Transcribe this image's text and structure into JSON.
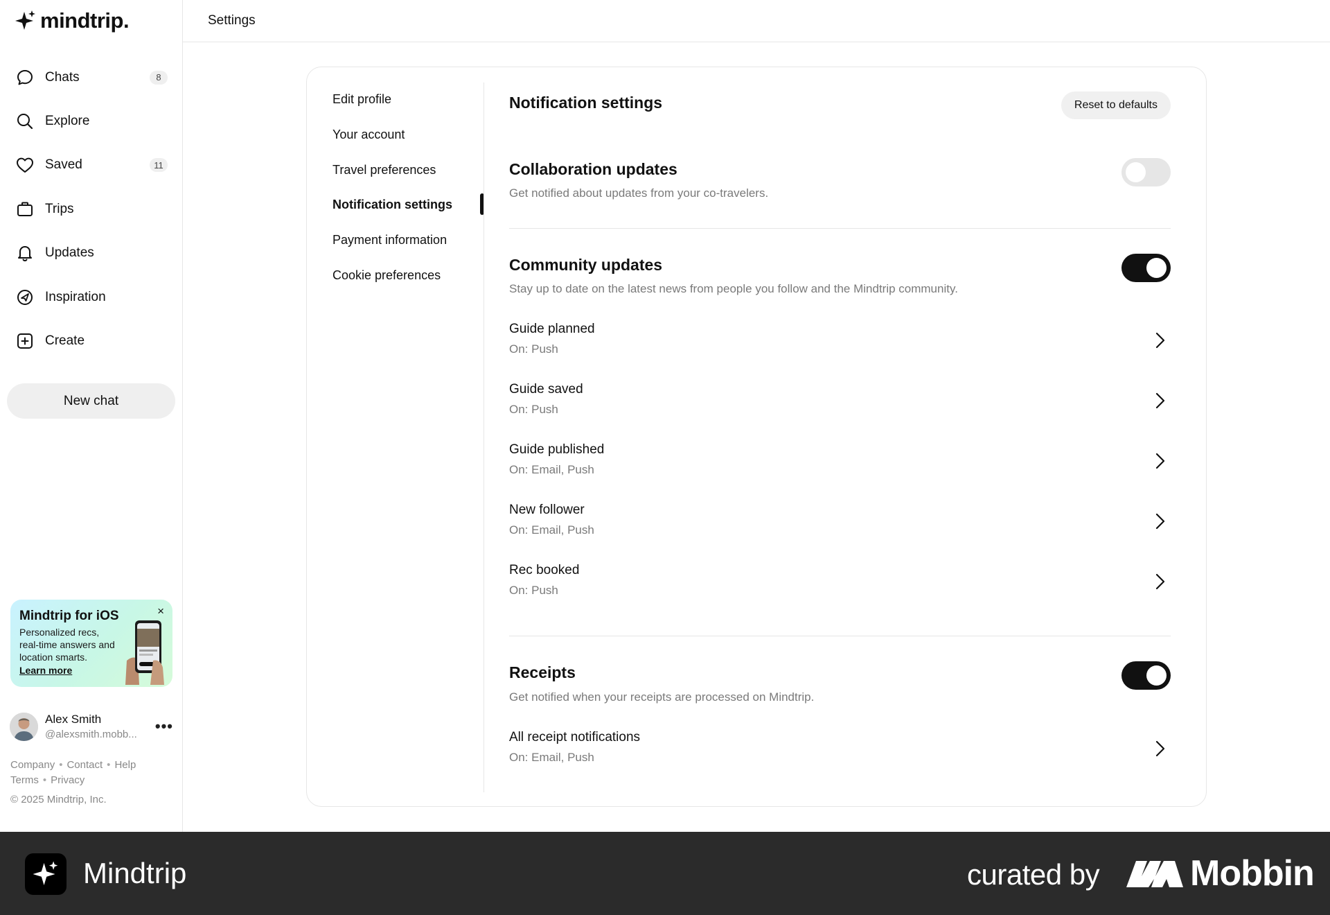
{
  "app": {
    "logo_text": "mindtrip."
  },
  "sidebar": {
    "items": [
      {
        "label": "Chats",
        "icon": "chat-bubble-icon",
        "badge": "8"
      },
      {
        "label": "Explore",
        "icon": "search-icon",
        "badge": null
      },
      {
        "label": "Saved",
        "icon": "heart-icon",
        "badge": "11"
      },
      {
        "label": "Trips",
        "icon": "suitcase-icon",
        "badge": null
      },
      {
        "label": "Updates",
        "icon": "bell-icon",
        "badge": null
      },
      {
        "label": "Inspiration",
        "icon": "compass-icon",
        "badge": null
      },
      {
        "label": "Create",
        "icon": "plus-square-icon",
        "badge": null
      }
    ],
    "new_chat": "New chat",
    "promo": {
      "title": "Mindtrip for iOS",
      "description": "Personalized recs, real-time answers and location smarts.",
      "link": "Learn more",
      "close": "×"
    },
    "user": {
      "name": "Alex Smith",
      "handle": "@alexsmith.mobb...",
      "more": "•••"
    },
    "footer": {
      "links_row1": [
        "Company",
        "Contact",
        "Help"
      ],
      "links_row2": [
        "Terms",
        "Privacy"
      ],
      "copyright": "© 2025 Mindtrip, Inc."
    }
  },
  "header": {
    "title": "Settings"
  },
  "settings_nav": {
    "items": [
      "Edit profile",
      "Your account",
      "Travel preferences",
      "Notification settings",
      "Payment information",
      "Cookie preferences"
    ],
    "active_index": 3
  },
  "notifications": {
    "title": "Notification settings",
    "reset_label": "Reset to defaults",
    "collaboration": {
      "title": "Collaboration updates",
      "description": "Get notified about updates from your co-travelers.",
      "enabled": false
    },
    "community": {
      "title": "Community updates",
      "description": "Stay up to date on the latest news from people you follow and the Mindtrip community.",
      "enabled": true,
      "rows": [
        {
          "title": "Guide planned",
          "status": "On: Push"
        },
        {
          "title": "Guide saved",
          "status": "On: Push"
        },
        {
          "title": "Guide published",
          "status": "On: Email, Push"
        },
        {
          "title": "New follower",
          "status": "On: Email, Push"
        },
        {
          "title": "Rec booked",
          "status": "On: Push"
        }
      ]
    },
    "receipts": {
      "title": "Receipts",
      "description": "Get notified when your receipts are processed on Mindtrip.",
      "enabled": true,
      "rows": [
        {
          "title": "All receipt notifications",
          "status": "On: Email, Push"
        }
      ]
    }
  },
  "banner": {
    "app_name": "Mindtrip",
    "curated_by": "curated by",
    "brand": "Mobbin",
    "background": "#2b2b2b"
  }
}
